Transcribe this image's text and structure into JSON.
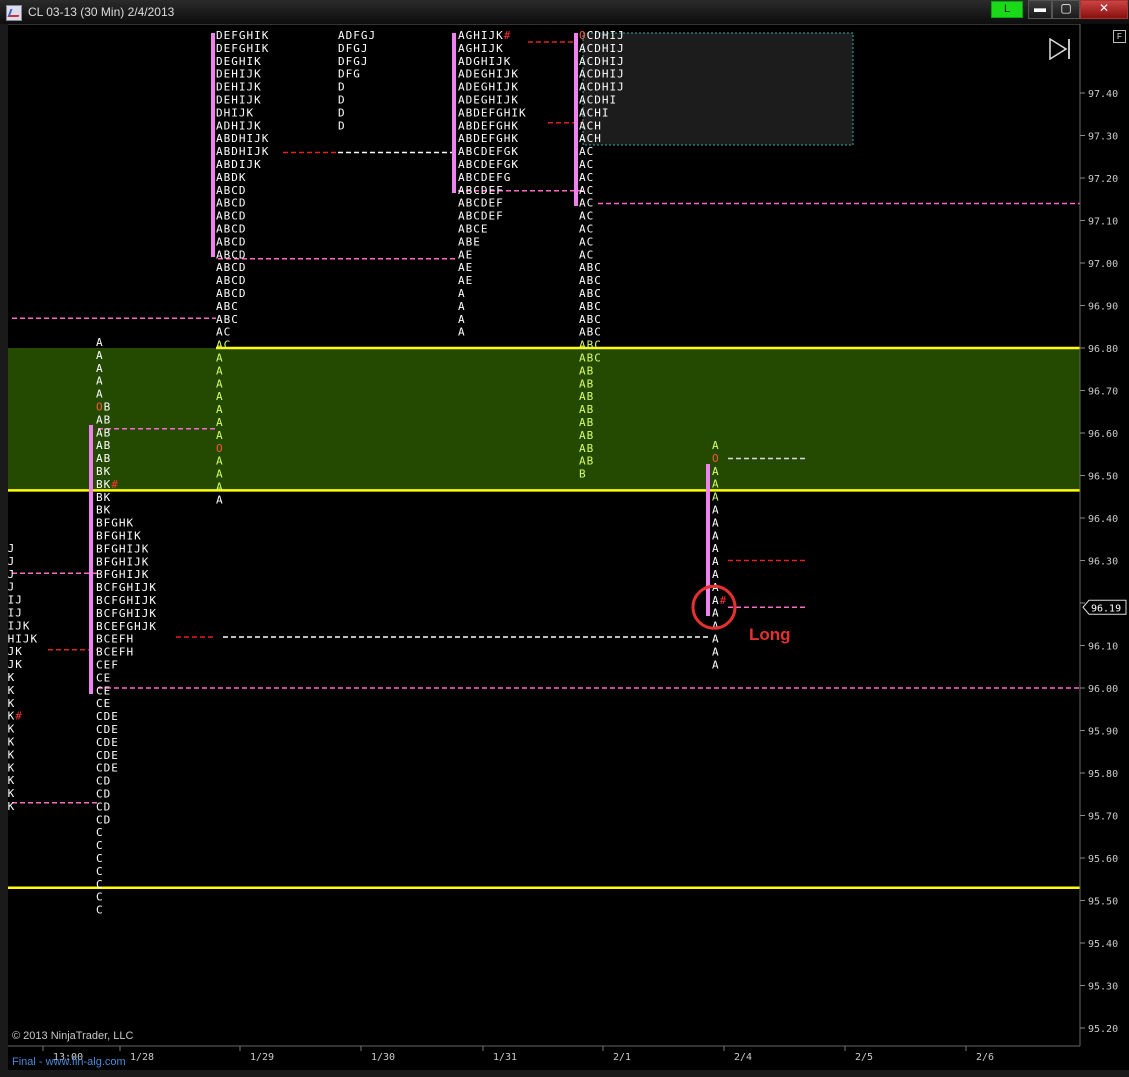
{
  "window": {
    "title": "CL 03-13 (30 Min)  2/4/2013",
    "connection_label": "L",
    "minimize": "▬",
    "maximize": "▢",
    "close": "✕",
    "icon": "chart-app-icon"
  },
  "toolbar": {
    "f_button": "F",
    "scroll_icon": "skip-forward-icon"
  },
  "colors": {
    "background": "#000000",
    "letters": "#ffffff",
    "letters_in_zone": "#d8ff6a",
    "value_area_bar": "#ee82ee",
    "zone_fill": "#234a00",
    "zone_line": "#ffff00",
    "poc_line": "#ffffff",
    "value_area_line": "#ff69c8",
    "ib_line": "#dd2222",
    "annotation": "#e53030",
    "open_marker": "#ff5533"
  },
  "price_axis": {
    "labels": [
      "97.40",
      "97.30",
      "97.20",
      "97.10",
      "97.00",
      "96.90",
      "96.80",
      "96.70",
      "96.60",
      "96.50",
      "96.40",
      "96.30",
      "96.20",
      "96.10",
      "96.00",
      "95.90",
      "95.80",
      "95.70",
      "95.60",
      "95.50",
      "95.40",
      "95.30",
      "95.20"
    ],
    "current_price": "96.19"
  },
  "time_axis": {
    "labels": [
      "13:00",
      "1/28",
      "1/29",
      "1/30",
      "1/31",
      "2/1",
      "2/4",
      "2/5",
      "2/6"
    ]
  },
  "profiles": [
    {
      "rows": [
        "IJ",
        "IJ",
        "IJ",
        "IJ",
        "DIJ",
        "DIJ",
        "DIJK",
        "DHIJK",
        "IJK",
        "IJK",
        "JK",
        "JK",
        "JK",
        "IK#",
        "IK",
        "GK",
        "GK",
        "GK",
        "GK",
        "GK",
        "GK"
      ],
      "prefix": ""
    },
    {
      "rows": [
        "A",
        "A",
        "A",
        "A",
        "A",
        "OB",
        "AB",
        "AB",
        "AB",
        "AB",
        "BK",
        "BK#",
        "BK",
        "BK",
        "BFGHK",
        "BFGHIK",
        "BFGHIJK",
        "BFGHIJK",
        "BFGHIJK",
        "BCFGHIJK",
        "BCFGHIJK",
        "BCFGHIJK",
        "BCEFGHJK",
        "BCEFH",
        "BCEFH",
        "CEF",
        "CE",
        "CE",
        "CE",
        "CDE",
        "CDE",
        "CDE",
        "CDE",
        "CDE",
        "CD",
        "CD",
        "CD",
        "CD",
        "C",
        "C",
        "C",
        "C",
        "C",
        "C",
        "C"
      ]
    },
    {
      "rows": [
        "DEFGHIK",
        "DEFGHIK",
        "DEGHIK",
        "DEHIJK",
        "DEHIJK",
        "DEHIJK",
        "DHIJK",
        "ADHIJK",
        "ABDHIJK",
        "ABDHIJK",
        "ABDIJK",
        "ABDK",
        "ABCD",
        "ABCD",
        "ABCD",
        "ABCD",
        "ABCD",
        "ABCD",
        "ABCD",
        "ABCD",
        "ABCD",
        "ABC",
        "ABC",
        "AC",
        "AC",
        "A",
        "A",
        "A",
        "A",
        "A",
        "A",
        "A",
        "O",
        "A",
        "A",
        "A",
        "A"
      ]
    },
    {
      "rows": [
        "ADFGJ",
        "DFGJ",
        "DFGJ",
        "DFG",
        "D",
        "D",
        "D",
        "D"
      ]
    },
    {
      "rows": [
        "AGHIJK#",
        "AGHIJK",
        "ADGHIJK",
        "ADEGHIJK",
        "ADEGHIJK",
        "ADEGHIJK",
        "ABDEFGHIK",
        "ABDEFGHK",
        "ABDEFGHK",
        "ABCDEFGK",
        "ABCDEFGK",
        "ABCDEFG",
        "ABCDEF",
        "ABCDEF",
        "ABCDEF",
        "ABCE",
        "ABE",
        "AE",
        "AE",
        "AE",
        "A",
        "A",
        "A",
        "A"
      ]
    },
    {
      "rows": [
        "OCDHIJ",
        "ACDHIJ",
        "ACDHIJ",
        "ACDHIJ",
        "ACDHIJ",
        "ACDHI",
        "ACHI",
        "ACH",
        "ACH",
        "AC",
        "AC",
        "AC",
        "AC",
        "AC",
        "AC",
        "AC",
        "AC",
        "AC",
        "ABC",
        "ABC",
        "ABC",
        "ABC",
        "ABC",
        "ABC",
        "ABC",
        "ABC",
        "AB",
        "AB",
        "AB",
        "AB",
        "AB",
        "AB",
        "AB",
        "AB",
        "B"
      ]
    },
    {
      "rows": [
        "A",
        "O",
        "A",
        "A",
        "A",
        "A",
        "A",
        "A",
        "A",
        "A",
        "A",
        "A",
        "A#",
        "A",
        "A",
        "A",
        "A",
        "A"
      ]
    }
  ],
  "annotation": {
    "label": "Long",
    "circle_price": 96.19
  },
  "copyright": "© 2013 NinjaTrader, LLC",
  "footer": "Final - www.fin-alg.com"
}
